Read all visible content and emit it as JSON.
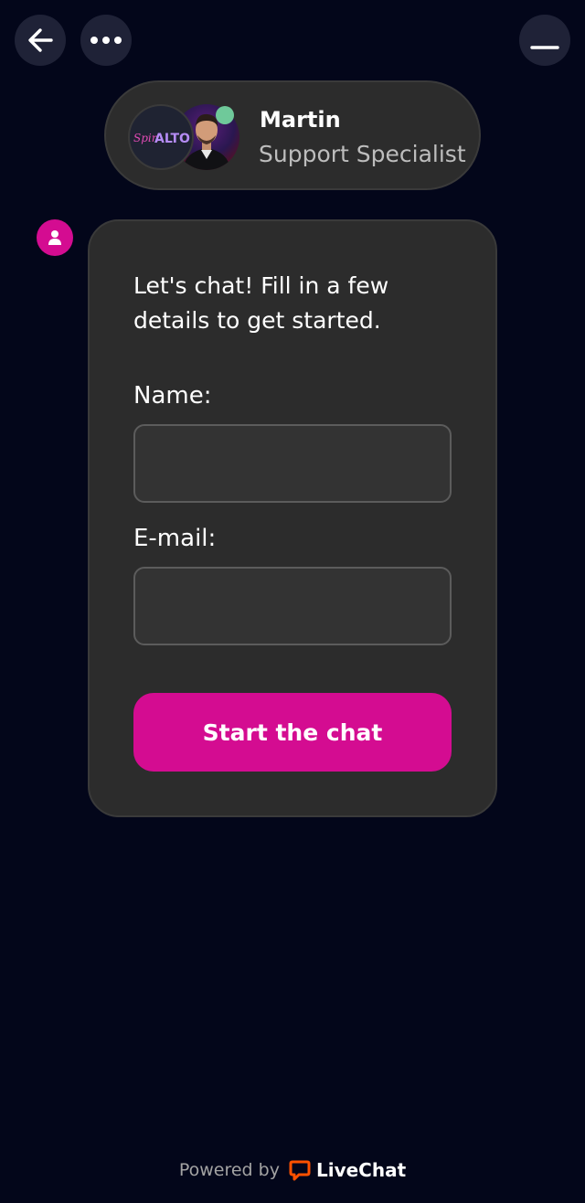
{
  "header": {
    "back_icon": "arrow-left-icon",
    "more_icon": "ellipsis-icon",
    "minimize_icon": "minimize-icon"
  },
  "agent": {
    "name": "Martin",
    "role": "Support Specialist",
    "brand_logo": "Spin ALTO",
    "brand_logo_prefix": "Spin",
    "brand_logo_main": "ALTO",
    "status_color": "#6fc99a"
  },
  "form": {
    "intro": "Let's chat! Fill in a few details to get started.",
    "name_label": "Name:",
    "name_value": "",
    "email_label": "E-mail:",
    "email_value": "",
    "submit_label": "Start the chat"
  },
  "footer": {
    "powered_by": "Powered by",
    "brand": "LiveChat"
  },
  "colors": {
    "background": "#03061a",
    "accent": "#d40c91",
    "card": "#2c2c2c",
    "livechat_orange": "#ff5100"
  }
}
